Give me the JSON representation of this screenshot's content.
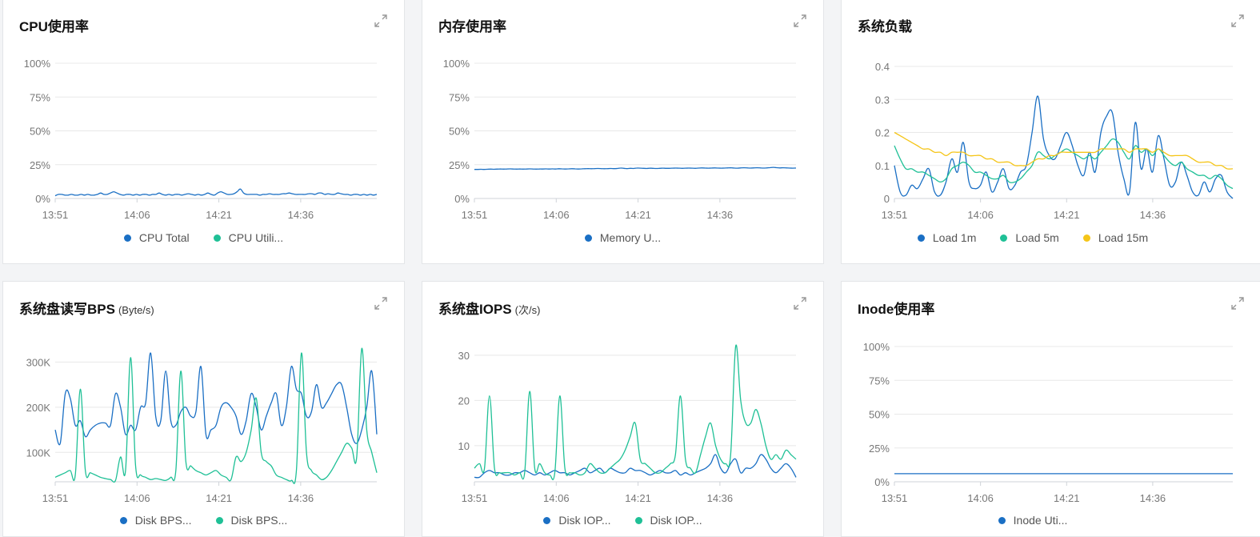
{
  "colors": {
    "blue": "#1a6fc4",
    "green": "#1fc096",
    "yellow": "#f5c518"
  },
  "icons": {
    "expand": "expand-icon"
  },
  "panels": {
    "cpu": {
      "title": "CPU使用率",
      "unit": "",
      "legend": [
        {
          "label": "CPU Total",
          "color": "#1a6fc4"
        },
        {
          "label": "CPU Utili...",
          "color": "#1fc096"
        }
      ]
    },
    "mem": {
      "title": "内存使用率",
      "unit": "",
      "legend": [
        {
          "label": "Memory U...",
          "color": "#1a6fc4"
        }
      ]
    },
    "load": {
      "title": "系统负载",
      "unit": "",
      "legend": [
        {
          "label": "Load 1m",
          "color": "#1a6fc4"
        },
        {
          "label": "Load 5m",
          "color": "#1fc096"
        },
        {
          "label": "Load 15m",
          "color": "#f5c518"
        }
      ]
    },
    "bps": {
      "title": "系统盘读写BPS",
      "unit": "(Byte/s)",
      "legend": [
        {
          "label": "Disk BPS...",
          "color": "#1a6fc4"
        },
        {
          "label": "Disk BPS...",
          "color": "#1fc096"
        }
      ]
    },
    "iops": {
      "title": "系统盘IOPS",
      "unit": "(次/s)",
      "legend": [
        {
          "label": "Disk IOP...",
          "color": "#1a6fc4"
        },
        {
          "label": "Disk IOP...",
          "color": "#1fc096"
        }
      ]
    },
    "inode": {
      "title": "Inode使用率",
      "unit": "",
      "legend": [
        {
          "label": "Inode Uti...",
          "color": "#1a6fc4"
        }
      ]
    }
  },
  "chart_data": [
    {
      "id": "cpu",
      "type": "line",
      "xticks": [
        "13:51",
        "14:06",
        "14:21",
        "14:36"
      ],
      "yticks": [
        "0%",
        "25%",
        "50%",
        "75%",
        "100%"
      ],
      "ylim": [
        0,
        100
      ],
      "series": [
        {
          "name": "CPU Total",
          "color": "#1a6fc4",
          "values": [
            2,
            3,
            3,
            2.5,
            2.5,
            3,
            2.5,
            2.5,
            3,
            2.5,
            3,
            2.5,
            2.5,
            3,
            4,
            3,
            3,
            4,
            5,
            4,
            3,
            2.5,
            3,
            3,
            2.5,
            3,
            2.5,
            3,
            3,
            2.5,
            3,
            3,
            4,
            3,
            2.5,
            3,
            2.5,
            3,
            3,
            2.5,
            3,
            3.5,
            3,
            2.5,
            3,
            2.5,
            3,
            4,
            3,
            2.5,
            4,
            5,
            4,
            3,
            3,
            3.5,
            5,
            7,
            4,
            3,
            3,
            3,
            3,
            2.5,
            3,
            3,
            3.5,
            3,
            3,
            3,
            3.5,
            3.5,
            4,
            3.5,
            3,
            3,
            3,
            3,
            3.5,
            3.5,
            3,
            4,
            4,
            3,
            3.5,
            3,
            3,
            4,
            3.5,
            3,
            3,
            2.5,
            3,
            3,
            2.5,
            3,
            2.5,
            3,
            2.5,
            3
          ]
        },
        {
          "name": "CPU Utili...",
          "color": "#1fc096",
          "values": []
        }
      ]
    },
    {
      "id": "mem",
      "type": "line",
      "xticks": [
        "13:51",
        "14:06",
        "14:21",
        "14:36"
      ],
      "yticks": [
        "0%",
        "25%",
        "50%",
        "75%",
        "100%"
      ],
      "ylim": [
        0,
        100
      ],
      "series": [
        {
          "name": "Memory U...",
          "color": "#1a6fc4",
          "values": [
            21.5,
            21.5,
            21.6,
            21.5,
            21.6,
            21.7,
            21.6,
            21.7,
            21.8,
            21.7,
            21.8,
            21.9,
            21.8,
            21.7,
            21.8,
            21.7,
            21.8,
            21.9,
            21.8,
            21.7,
            21.8,
            21.8,
            21.9,
            21.8,
            21.9,
            21.8,
            22.0,
            21.9,
            21.8,
            21.9,
            22.0,
            21.9,
            21.8,
            21.9,
            22.0,
            22.1,
            22.0,
            22.1,
            22.2,
            22.1,
            22.0,
            22.1,
            22.2,
            22.1,
            22.2,
            22.5,
            22.3,
            22.1,
            22.3,
            22.2,
            22.5,
            22.4,
            22.3,
            22.2,
            22.4,
            22.3,
            22.2,
            22.3,
            22.4,
            22.3,
            22.3,
            22.4,
            22.5,
            22.4,
            22.3,
            22.4,
            22.5,
            22.4,
            22.3,
            22.5,
            22.6,
            22.5,
            22.4,
            22.5,
            22.6,
            22.5,
            22.4,
            22.5,
            22.6,
            22.7,
            22.5,
            22.4,
            22.6,
            22.7,
            22.6,
            22.5,
            22.6,
            22.7,
            22.6,
            22.5,
            22.6,
            22.8,
            23.0,
            22.8,
            22.6,
            22.7,
            22.6,
            22.5,
            22.4,
            22.5
          ]
        }
      ]
    },
    {
      "id": "load",
      "type": "line",
      "xticks": [
        "13:51",
        "14:06",
        "14:21",
        "14:36"
      ],
      "yticks": [
        "0",
        "0.1",
        "0.2",
        "0.3",
        "0.4"
      ],
      "ylim": [
        0,
        0.4
      ],
      "series": [
        {
          "name": "Load 1m",
          "color": "#1a6fc4",
          "values": [
            0.1,
            0.02,
            0.01,
            0.04,
            0.03,
            0.06,
            0.09,
            0.02,
            0.01,
            0.05,
            0.12,
            0.08,
            0.17,
            0.05,
            0.03,
            0.04,
            0.08,
            0.02,
            0.05,
            0.09,
            0.03,
            0.04,
            0.08,
            0.1,
            0.2,
            0.31,
            0.18,
            0.13,
            0.12,
            0.16,
            0.2,
            0.16,
            0.1,
            0.07,
            0.14,
            0.08,
            0.2,
            0.25,
            0.26,
            0.14,
            0.06,
            0.02,
            0.23,
            0.09,
            0.15,
            0.08,
            0.19,
            0.12,
            0.04,
            0.05,
            0.11,
            0.07,
            0.02,
            0.01,
            0.05,
            0.02,
            0.06,
            0.07,
            0.02,
            0.0
          ]
        },
        {
          "name": "Load 5m",
          "color": "#1fc096",
          "values": [
            0.16,
            0.12,
            0.09,
            0.09,
            0.08,
            0.08,
            0.07,
            0.06,
            0.05,
            0.06,
            0.09,
            0.1,
            0.11,
            0.1,
            0.08,
            0.08,
            0.07,
            0.06,
            0.06,
            0.07,
            0.05,
            0.05,
            0.06,
            0.08,
            0.1,
            0.14,
            0.13,
            0.12,
            0.13,
            0.14,
            0.15,
            0.14,
            0.13,
            0.12,
            0.13,
            0.12,
            0.14,
            0.16,
            0.18,
            0.17,
            0.14,
            0.12,
            0.16,
            0.14,
            0.15,
            0.13,
            0.15,
            0.13,
            0.11,
            0.1,
            0.11,
            0.09,
            0.08,
            0.07,
            0.07,
            0.06,
            0.07,
            0.06,
            0.04,
            0.03
          ]
        },
        {
          "name": "Load 15m",
          "color": "#f5c518",
          "values": [
            0.2,
            0.19,
            0.18,
            0.17,
            0.16,
            0.15,
            0.15,
            0.14,
            0.14,
            0.13,
            0.14,
            0.14,
            0.14,
            0.13,
            0.13,
            0.13,
            0.12,
            0.12,
            0.11,
            0.11,
            0.11,
            0.1,
            0.1,
            0.1,
            0.11,
            0.12,
            0.12,
            0.13,
            0.13,
            0.14,
            0.14,
            0.14,
            0.14,
            0.14,
            0.14,
            0.14,
            0.15,
            0.15,
            0.15,
            0.15,
            0.15,
            0.14,
            0.15,
            0.15,
            0.15,
            0.14,
            0.15,
            0.14,
            0.13,
            0.13,
            0.13,
            0.13,
            0.12,
            0.11,
            0.11,
            0.11,
            0.1,
            0.1,
            0.09,
            0.09
          ]
        }
      ]
    },
    {
      "id": "bps",
      "type": "line",
      "xticks": [
        "13:51",
        "14:06",
        "14:21",
        "14:36"
      ],
      "yticks": [
        "100K",
        "200K",
        "300K"
      ],
      "ylim": [
        35000,
        345000
      ],
      "series": [
        {
          "name": "Disk BPS...",
          "color": "#1a6fc4",
          "values": [
            150000,
            120000,
            230000,
            220000,
            160000,
            170000,
            135000,
            150000,
            160000,
            165000,
            165000,
            160000,
            230000,
            200000,
            140000,
            160000,
            150000,
            200000,
            210000,
            320000,
            180000,
            170000,
            280000,
            170000,
            160000,
            190000,
            200000,
            180000,
            190000,
            290000,
            140000,
            150000,
            160000,
            200000,
            210000,
            200000,
            180000,
            140000,
            170000,
            230000,
            200000,
            150000,
            180000,
            210000,
            230000,
            160000,
            200000,
            290000,
            240000,
            230000,
            180000,
            190000,
            250000,
            200000,
            210000,
            230000,
            250000,
            250000,
            200000,
            140000,
            120000,
            150000,
            200000,
            280000,
            140000
          ]
        },
        {
          "name": "Disk BPS...",
          "color": "#1fc096",
          "values": [
            45000,
            50000,
            55000,
            60000,
            50000,
            240000,
            60000,
            55000,
            50000,
            45000,
            42000,
            40000,
            38000,
            90000,
            60000,
            310000,
            70000,
            50000,
            45000,
            40000,
            42000,
            40000,
            38000,
            45000,
            60000,
            280000,
            80000,
            70000,
            60000,
            55000,
            50000,
            55000,
            60000,
            50000,
            45000,
            40000,
            90000,
            80000,
            100000,
            150000,
            220000,
            100000,
            80000,
            70000,
            50000,
            45000,
            40000,
            38000,
            60000,
            320000,
            100000,
            60000,
            50000,
            40000,
            45000,
            60000,
            80000,
            100000,
            120000,
            110000,
            90000,
            330000,
            150000,
            100000,
            55000
          ]
        }
      ]
    },
    {
      "id": "iops",
      "type": "line",
      "xticks": [
        "13:51",
        "14:06",
        "14:21",
        "14:36"
      ],
      "yticks": [
        "10",
        "20",
        "30"
      ],
      "ylim": [
        2,
        33
      ],
      "series": [
        {
          "name": "Disk IOP...",
          "color": "#1a6fc4",
          "values": [
            3,
            3,
            4,
            4.5,
            4,
            4,
            3.5,
            3.5,
            4,
            4,
            4.5,
            4,
            3.5,
            4,
            3.5,
            4,
            4.5,
            4,
            4,
            3.5,
            4,
            4.5,
            5,
            4,
            4.5,
            5,
            4,
            5,
            4.5,
            4,
            4,
            5,
            4.5,
            4.5,
            4,
            3.5,
            4,
            4.5,
            4,
            4,
            4.5,
            3.5,
            4,
            3.5,
            4,
            4.5,
            5,
            6,
            8,
            5,
            4,
            6,
            7,
            4,
            5,
            5,
            6,
            8,
            7,
            5,
            4,
            5,
            6,
            5,
            3
          ]
        },
        {
          "name": "Disk IOP...",
          "color": "#1fc096",
          "values": [
            5,
            6,
            5,
            21,
            5,
            4,
            4,
            4,
            3.5,
            4,
            4,
            22,
            5,
            6,
            4,
            3.5,
            4,
            21,
            5,
            4,
            4,
            3.5,
            4,
            6,
            5,
            4,
            4,
            5,
            6,
            7,
            9,
            12,
            15,
            7,
            6,
            5,
            4,
            4,
            5,
            6,
            8,
            21,
            7,
            5,
            4,
            8,
            12,
            15,
            10,
            7,
            6,
            8,
            32,
            20,
            15,
            15,
            18,
            15,
            10,
            7,
            8,
            7,
            9,
            8,
            7
          ]
        }
      ]
    },
    {
      "id": "inode",
      "type": "line",
      "xticks": [
        "13:51",
        "14:06",
        "14:21",
        "14:36"
      ],
      "yticks": [
        "0%",
        "25%",
        "50%",
        "75%",
        "100%"
      ],
      "ylim": [
        0,
        100
      ],
      "series": [
        {
          "name": "Inode Uti...",
          "color": "#1a6fc4",
          "values": [
            6,
            6,
            6,
            6,
            6,
            6,
            6,
            6,
            6,
            6,
            6,
            6,
            6,
            6,
            6,
            6,
            6,
            6,
            6,
            6,
            6,
            6,
            6,
            6,
            6,
            6,
            6,
            6,
            6,
            6,
            6,
            6,
            6,
            6,
            6,
            6,
            6,
            6,
            6,
            6
          ]
        }
      ]
    }
  ]
}
